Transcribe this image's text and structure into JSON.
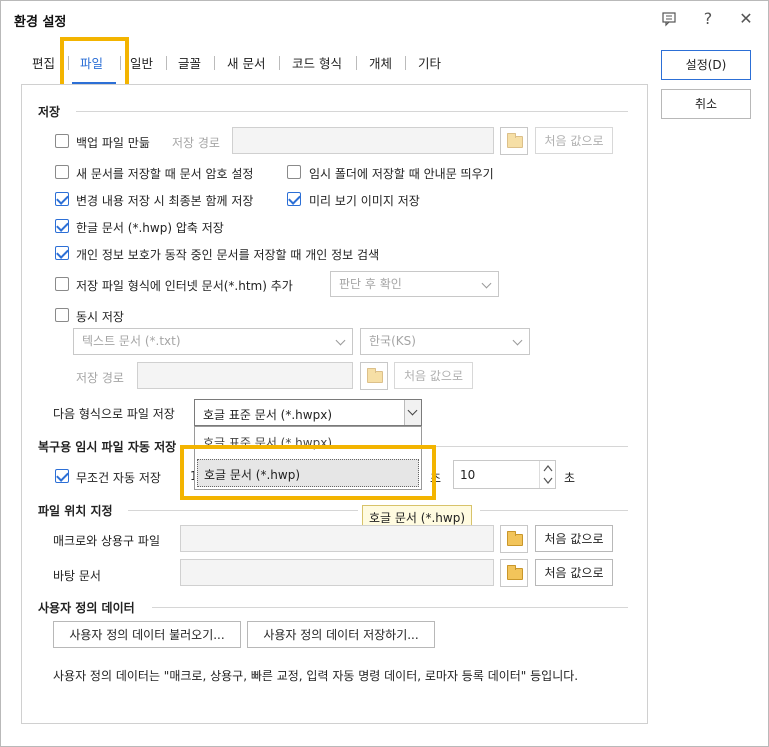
{
  "window": {
    "title": "환경 설정",
    "help_glyph": "?",
    "close_glyph": "✕"
  },
  "tabs": [
    {
      "label": "편집"
    },
    {
      "label": "파일"
    },
    {
      "label": "일반"
    },
    {
      "label": "글꼴"
    },
    {
      "label": "새 문서"
    },
    {
      "label": "코드 형식"
    },
    {
      "label": "개체"
    },
    {
      "label": "기타"
    }
  ],
  "active_tab": "파일",
  "actions": {
    "ok": "설정(D)",
    "cancel": "취소"
  },
  "save": {
    "title": "저장",
    "backup": {
      "label": "백업 파일 만듦",
      "checked": false
    },
    "save_path_label": "저장 경로",
    "default_btn": "처음 값으로",
    "doc_password": {
      "label": "새 문서를 저장할 때 문서 암호 설정",
      "checked": false
    },
    "temp_folder_notice": {
      "label": "임시 폴더에 저장할 때 안내문 띄우기",
      "checked": false
    },
    "save_latest_with_changes": {
      "label": "변경 내용 저장 시 최종본 함께 저장",
      "checked": true
    },
    "preview_image": {
      "label": "미리 보기 이미지 저장",
      "checked": true
    },
    "compress_hwp": {
      "label": "한글 문서 (*.hwp) 압축 저장",
      "checked": true
    },
    "privacy_check": {
      "label": "개인 정보 보호가 동작 중인 문서를 저장할 때 개인 정보 검색",
      "checked": true
    },
    "add_htm": {
      "label": "저장 파일 형식에 인터넷 문서(*.htm) 추가",
      "checked": false
    },
    "add_htm_select": "판단 후 확인",
    "sync_save": {
      "label": "동시 저장",
      "checked": false
    },
    "sync_format_select": "텍스트 문서 (*.txt)",
    "sync_encoding_select": "한국(KS)",
    "sync_path_label": "저장 경로",
    "sync_default_btn": "처음 값으로",
    "save_as_label": "다음 형식으로 파일 저장",
    "save_as_value": "호글 표준 문서 (*.hwpx)",
    "dropdown_options": [
      "호글 표준 문서 (*.hwpx)",
      "호글 문서 (*.hwp)"
    ],
    "tooltip": "호글 문서 (*.hwp)"
  },
  "autosave": {
    "title": "복구용 임시 파일 자동 저장",
    "unconditional": {
      "label": "무조건 자동 저장",
      "checked": true
    },
    "unconditional_value_partial": "1",
    "idle_label_partial": "초",
    "idle_value": "10",
    "unit": "초"
  },
  "file_location": {
    "title": "파일 위치 지정",
    "macro_label": "매크로와 상용구 파일",
    "macro_default_btn": "처음 값으로",
    "background_label": "바탕 문서",
    "background_default_btn": "처음 값으로"
  },
  "user_data": {
    "title": "사용자 정의 데이터",
    "load_btn": "사용자 정의 데이터 불러오기...",
    "save_btn": "사용자 정의 데이터 저장하기...",
    "description": "사용자 정의 데이터는 \"매크로, 상용구, 빠른 교정, 입력 자동 명령 데이터, 로마자 등록 데이터\" 등입니다."
  },
  "colors": {
    "accent": "#2c6fd6",
    "highlight": "#f3b400",
    "tooltip_bg": "#fffbe0"
  }
}
